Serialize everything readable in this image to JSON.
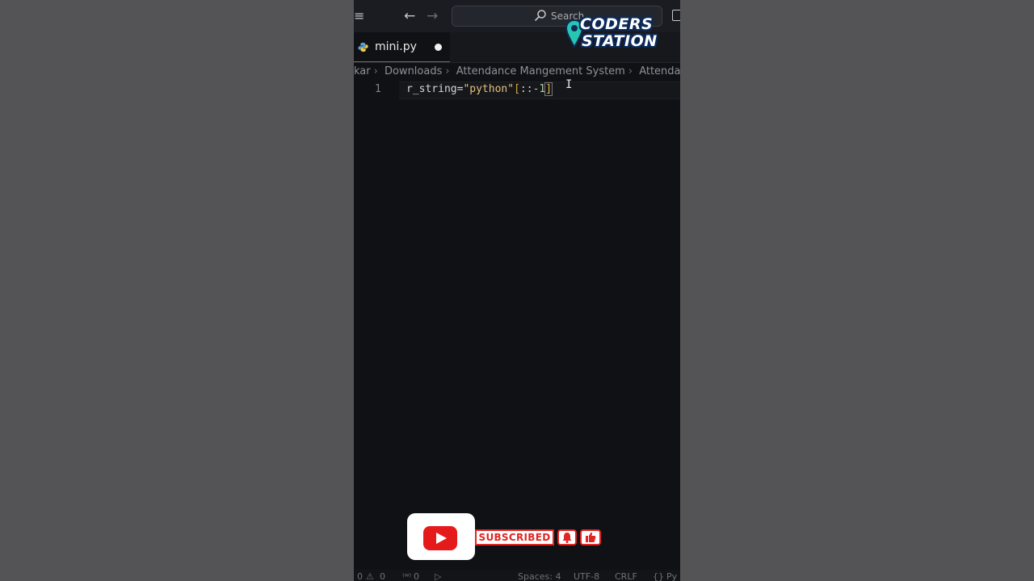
{
  "titlebar": {
    "menu_icon": "menu-icon",
    "back_icon": "arrow-left-icon",
    "forward_icon": "arrow-right-icon",
    "search_label": "Search",
    "search_icon": "search-icon",
    "layout_icon": "layout-icon"
  },
  "tab": {
    "label": "mini.py",
    "icon": "python-icon",
    "modified_icon": "unsaved-dot-icon"
  },
  "logo": {
    "line1": "CODERS",
    "line2": "STATION"
  },
  "breadcrumbs": [
    "kar",
    "Downloads",
    "Attendance Mangement System",
    "Attendance"
  ],
  "editor": {
    "line_number": "1",
    "code": {
      "var": "r_string",
      "op": "=",
      "str": "\"python\"",
      "open": "[",
      "slice": "::",
      "num": "-1",
      "close": "]"
    },
    "cursor_icon": "ibeam-cursor-icon"
  },
  "overlay": {
    "youtube_icon": "youtube-icon",
    "subscribed_label": "SUBSCRIBED",
    "bell_icon": "bell-icon",
    "like_icon": "thumbs-up-icon"
  },
  "statusbar": {
    "errors": "0",
    "warnings": "0",
    "ports": "0",
    "spaces": "Spaces: 4",
    "encoding": "UTF-8",
    "eol": "CRLF",
    "language": "Py"
  },
  "colors": {
    "background": "#545456",
    "editor_bg": "#0f1115",
    "string": "#e6c07b",
    "youtube_red": "#e51b1b"
  }
}
